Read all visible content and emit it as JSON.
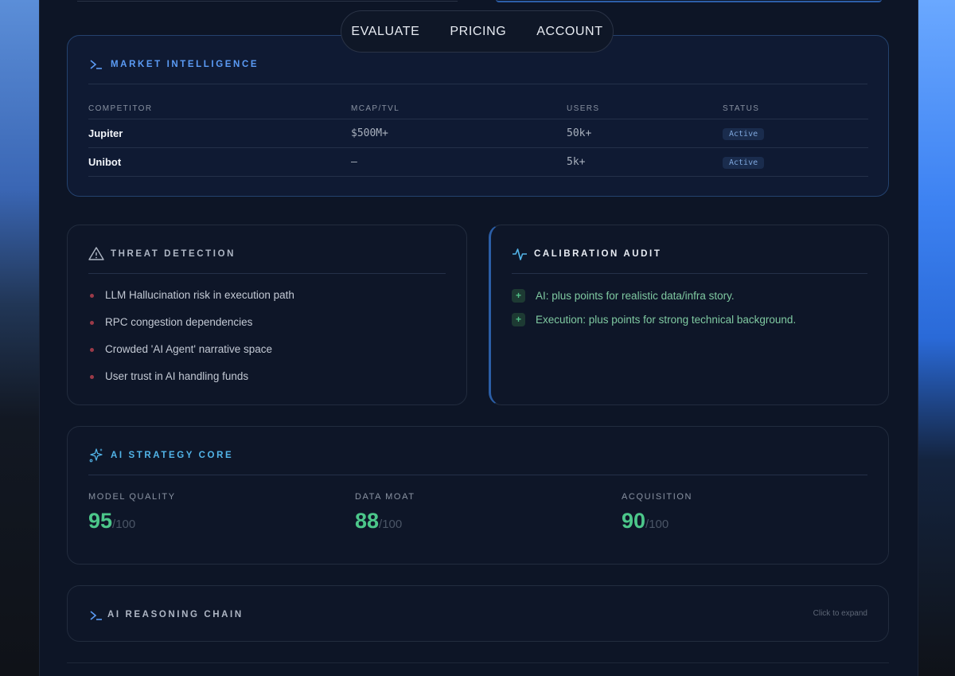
{
  "nav": {
    "items": [
      "EVALUATE",
      "PRICING",
      "ACCOUNT"
    ]
  },
  "market": {
    "title": "MARKET INTELLIGENCE",
    "columns": [
      "COMPETITOR",
      "MCAP/TVL",
      "USERS",
      "STATUS"
    ],
    "rows": [
      {
        "competitor": "Jupiter",
        "mcap": "$500M+",
        "users": "50k+",
        "status": "Active"
      },
      {
        "competitor": "Unibot",
        "mcap": "—",
        "users": "5k+",
        "status": "Active"
      }
    ]
  },
  "threat": {
    "title": "THREAT DETECTION",
    "items": [
      "LLM Hallucination risk in execution path",
      "RPC congestion dependencies",
      "Crowded 'AI Agent' narrative space",
      "User trust in AI handling funds"
    ]
  },
  "calibration": {
    "title": "CALIBRATION AUDIT",
    "items": [
      "AI: plus points for realistic data/infra story.",
      "Execution: plus points for strong technical background."
    ]
  },
  "strategy": {
    "title": "AI STRATEGY CORE",
    "metrics": [
      {
        "label": "MODEL QUALITY",
        "value": "95",
        "max": "/100"
      },
      {
        "label": "DATA MOAT",
        "value": "88",
        "max": "/100"
      },
      {
        "label": "ACQUISITION",
        "value": "90",
        "max": "/100"
      }
    ]
  },
  "reasoning": {
    "title": "AI REASONING CHAIN",
    "hint": "Click to expand"
  },
  "colors": {
    "accent": "#5b9bf5",
    "positive": "#4cc78a",
    "threat_dot": "#9b3a48"
  }
}
